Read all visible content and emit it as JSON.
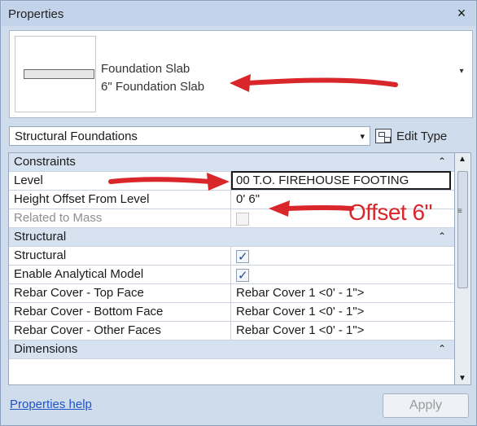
{
  "window": {
    "title": "Properties",
    "close_glyph": "×"
  },
  "type_selector": {
    "family": "Foundation Slab",
    "type": "6\" Foundation Slab",
    "dropdown_glyph": "▾"
  },
  "category": {
    "selected": "Structural Foundations",
    "dropdown_glyph": "▾",
    "edit_type_label": "Edit Type"
  },
  "groups": [
    {
      "label": "Constraints",
      "collapse_glyph": "⌃",
      "rows": [
        {
          "name": "Level",
          "value": "00 T.O. FIREHOUSE FOOTING"
        },
        {
          "name": "Height Offset From Level",
          "value": "0'  6\""
        },
        {
          "name": "Related to Mass",
          "value": ""
        }
      ]
    },
    {
      "label": "Structural",
      "collapse_glyph": "⌃",
      "rows": [
        {
          "name": "Structural",
          "value": "checked"
        },
        {
          "name": "Enable Analytical Model",
          "value": "checked"
        },
        {
          "name": "Rebar Cover - Top Face",
          "value": "Rebar Cover 1 <0' - 1\">"
        },
        {
          "name": "Rebar Cover - Bottom Face",
          "value": "Rebar Cover 1 <0' - 1\">"
        },
        {
          "name": "Rebar Cover - Other Faces",
          "value": "Rebar Cover 1 <0' - 1\">"
        }
      ]
    },
    {
      "label": "Dimensions",
      "collapse_glyph": "⌃"
    }
  ],
  "scroll": {
    "up_glyph": "▲",
    "down_glyph": "▼",
    "grip_glyph": "≡"
  },
  "footer": {
    "help_link": "Properties help",
    "apply_label": "Apply"
  },
  "annotation": {
    "offset_text": "Offset 6\"",
    "color": "#d8262a"
  }
}
